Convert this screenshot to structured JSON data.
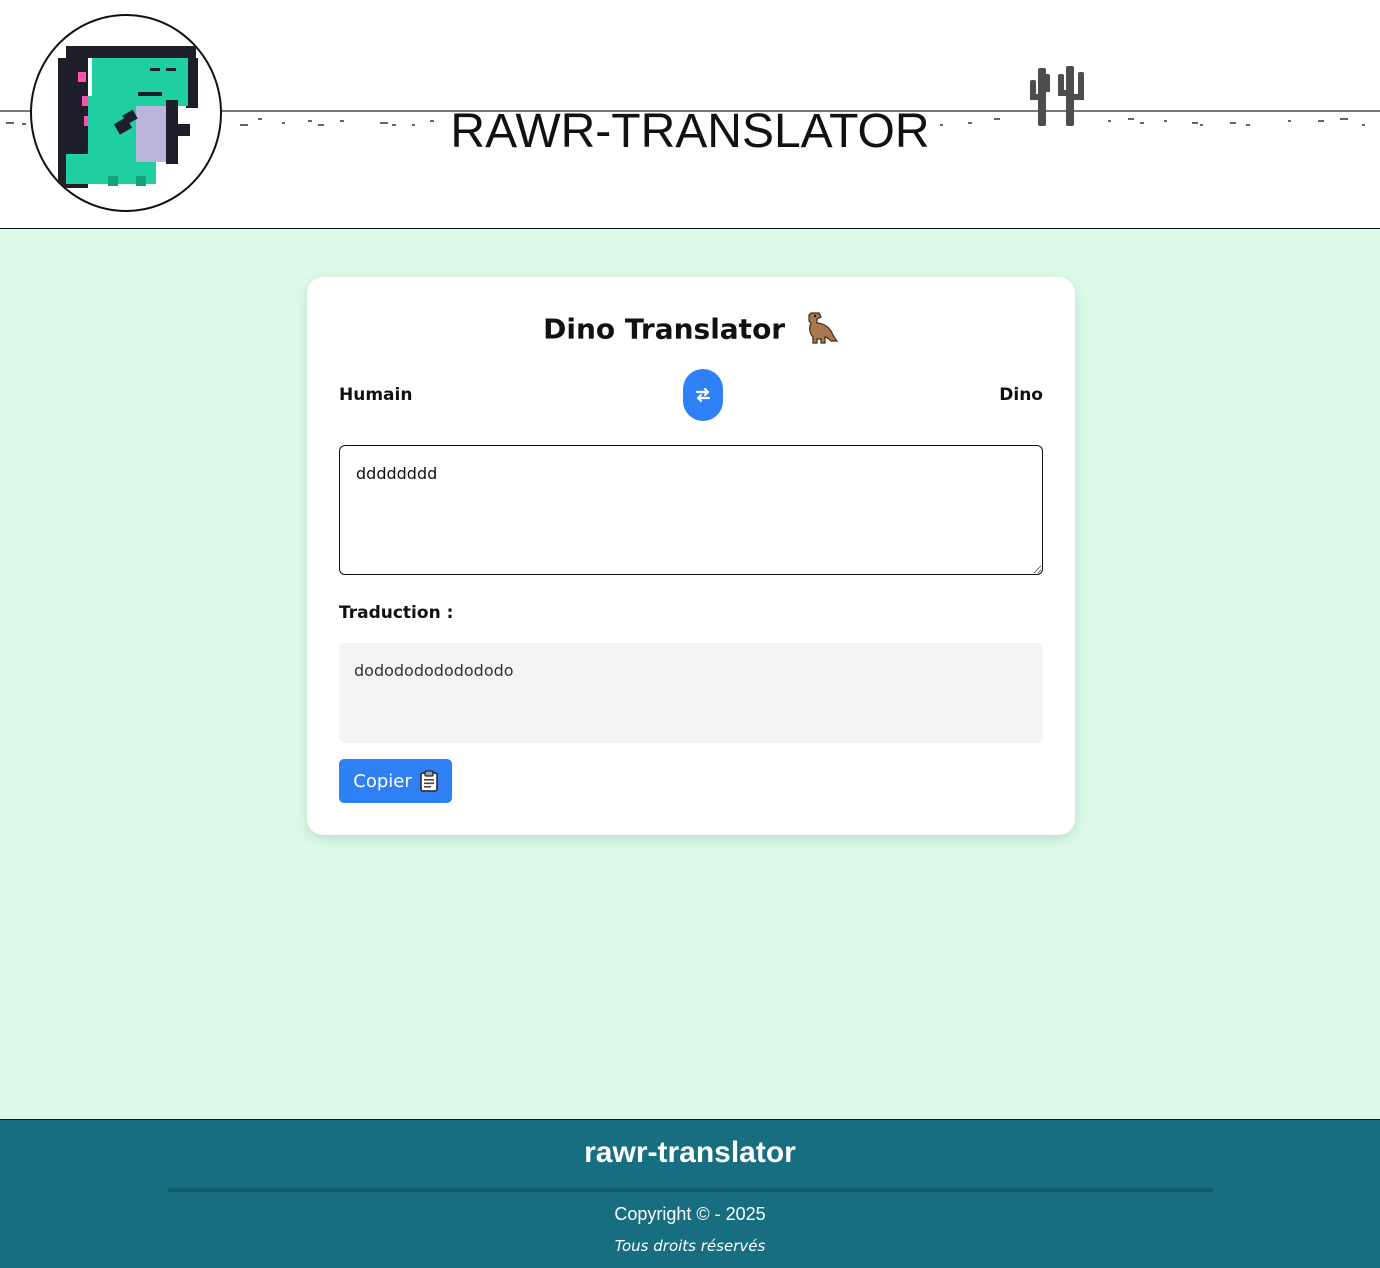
{
  "header": {
    "title": "RAWR-TRANSLATOR",
    "logo_icon": "pixel-dino-icon",
    "decoration_icon": "cactus-icon"
  },
  "card": {
    "title": "Dino Translator",
    "title_icon": "t-rex-emoji-icon",
    "source_language": "Humain",
    "target_language": "Dino",
    "swap_icon": "swap-arrows-icon",
    "input_value": "dddddddd",
    "translation_label": "Traduction :",
    "translation_output": "dodododododododo",
    "copy_label": "Copier",
    "copy_icon": "clipboard-icon"
  },
  "footer": {
    "title": "rawr-translator",
    "copyright": "Copyright © - 2025",
    "rights": "Tous droits réservés"
  },
  "colors": {
    "page_background": "#dbfbe8",
    "accent": "#2f80f5",
    "footer_background": "#176e80",
    "output_background": "#f3f4f6"
  }
}
